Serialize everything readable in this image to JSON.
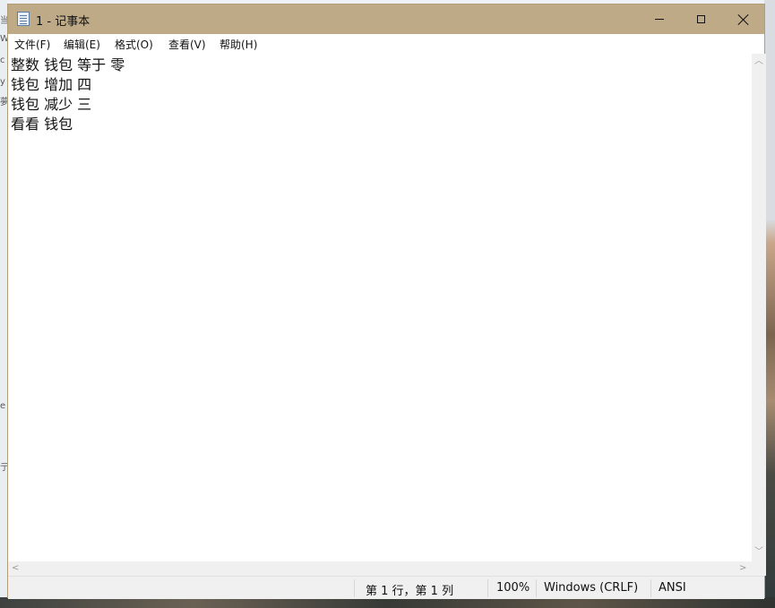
{
  "window": {
    "title": "1 - 记事本"
  },
  "menu": {
    "file": "文件(F)",
    "edit": "编辑(E)",
    "format": "格式(O)",
    "view": "查看(V)",
    "help": "帮助(H)"
  },
  "editor": {
    "lines": [
      "整数 钱包 等于 零",
      "钱包 增加 四",
      "钱包 减少 三",
      "看看 钱包"
    ]
  },
  "status": {
    "position": "第 1 行，第 1 列",
    "zoom": "100%",
    "line_ending": "Windows (CRLF)",
    "encoding": "ANSI"
  },
  "background": {
    "left_fragments": [
      "当",
      "W",
      "c",
      "y",
      "夢",
      "e",
      "亍"
    ]
  },
  "colors": {
    "titlebar": "#bfaa88",
    "window_border": "#b59c78",
    "statusbar": "#f0f0f0"
  }
}
